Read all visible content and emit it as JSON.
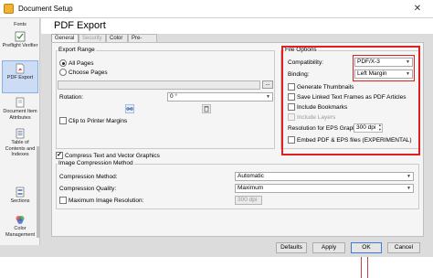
{
  "window": {
    "title": "Document Setup",
    "close_glyph": "✕"
  },
  "sidebar": {
    "items": [
      {
        "label": "Fonts",
        "icon": "fonts-icon"
      },
      {
        "label": "Preflight Verifier",
        "icon": "preflight-icon"
      },
      {
        "label": "PDF Export",
        "icon": "pdf-icon",
        "selected": true
      },
      {
        "label": "Document Item Attributes",
        "icon": "document-item-icon"
      },
      {
        "label": "Table of Contents and Indexes",
        "icon": "toc-icon"
      },
      {
        "label": "Sections",
        "icon": "sections-icon"
      },
      {
        "label": "Color Management",
        "icon": "color-management-icon"
      }
    ]
  },
  "header": {
    "title": "PDF Export"
  },
  "tabs": [
    {
      "label": "General",
      "active": true
    },
    {
      "label": "Security",
      "disabled": true
    },
    {
      "label": "Color"
    },
    {
      "label": "Pre-Press"
    }
  ],
  "export_range": {
    "group_label": "Export Range",
    "all_pages": "All Pages",
    "choose_pages": "Choose Pages",
    "pages_value": "",
    "browse_label": "...",
    "rotation_label": "Rotation:",
    "rotation_value": "0 °",
    "clip_label": "Clip to Printer Margins"
  },
  "file_options": {
    "group_label": "File Options",
    "compatibility_label": "Compatibility:",
    "compatibility_value": "PDF/X-3",
    "binding_label": "Binding:",
    "binding_value": "Left Margin",
    "generate_thumbnails": "Generate Thumbnails",
    "save_linked_text_frames": "Save Linked Text Frames as PDF Articles",
    "include_bookmarks": "Include Bookmarks",
    "include_layers": "Include Layers",
    "eps_resolution_label": "Resolution for EPS Graphics:",
    "eps_resolution_value": "300 dpi",
    "embed_pdf_eps": "Embed PDF & EPS files (EXPERIMENTAL)"
  },
  "compression": {
    "compress_text_vector": "Compress Text and Vector Graphics",
    "image_compression_group": "Image Compression Method",
    "method_label": "Compression Method:",
    "method_value": "Automatic",
    "quality_label": "Compression Quality:",
    "quality_value": "Maximum",
    "max_resolution_label": "Maximum Image Resolution:",
    "max_resolution_value": "300 dpi"
  },
  "buttons": {
    "defaults": "Defaults",
    "apply": "Apply",
    "ok": "OK",
    "cancel": "Cancel"
  },
  "colors": {
    "highlight_red": "#e02020",
    "selection_blue": "#cbdcf4"
  }
}
